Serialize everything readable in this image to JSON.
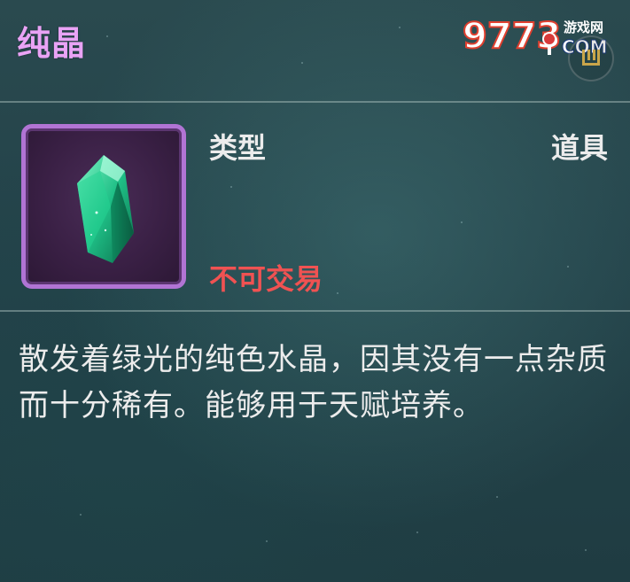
{
  "item": {
    "name": "纯晶",
    "type_label": "类型",
    "type_value": "道具",
    "trade_status": "不可交易",
    "description": "散发着绿光的纯色水晶，因其没有一点杂质而十分稀有。能够用于天赋培养。"
  },
  "watermark": {
    "number": "9773",
    "cn": "游戏网",
    "com": "COM"
  },
  "colors": {
    "title": "#e9a3f5",
    "trade_status": "#f05252",
    "frame_border": "#b174d4",
    "crystal": "#1fbf86"
  },
  "icons": {
    "item": "green-crystal-icon",
    "close": "close-icon"
  }
}
